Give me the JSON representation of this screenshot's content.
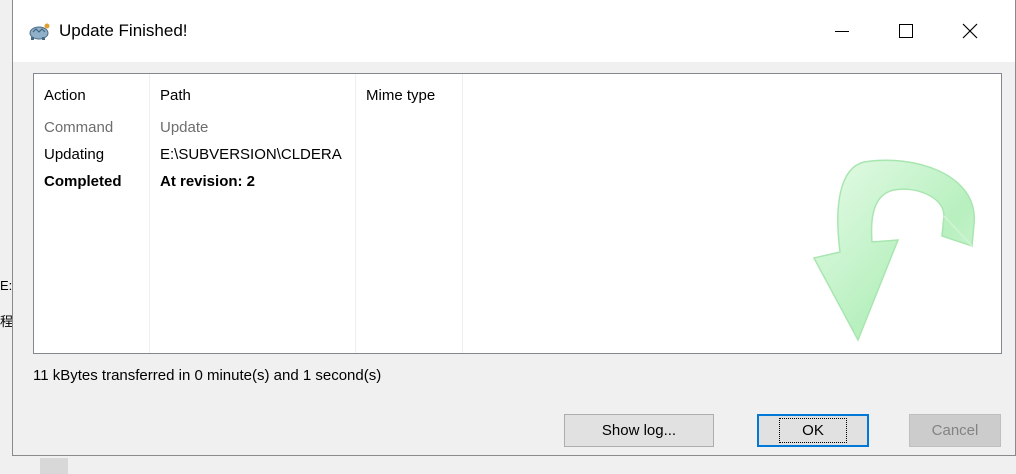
{
  "window": {
    "title": "Update Finished!",
    "controls": {
      "minimize": "minimize",
      "maximize": "maximize",
      "close": "close"
    }
  },
  "background": {
    "glyph_1": "E:",
    "glyph_2": "程"
  },
  "list": {
    "columns": [
      "Action",
      "Path",
      "Mime type"
    ],
    "rows": [
      {
        "action": "Command",
        "path": "Update",
        "style": "grey"
      },
      {
        "action": "Updating",
        "path": "E:\\SUBVERSION\\CLDERA",
        "style": "normal"
      },
      {
        "action": "Completed",
        "path": "At revision: 2",
        "style": "bold"
      }
    ]
  },
  "status": {
    "text": "11 kBytes transferred in 0 minute(s) and 1 second(s)"
  },
  "buttons": {
    "show_log": "Show log...",
    "ok": "OK",
    "cancel": "Cancel"
  },
  "icons": {
    "app": "tortoise-icon",
    "watermark": "update-arrow-icon"
  },
  "colors": {
    "accent": "#0078d7",
    "arrow_green": "#b8f0bf"
  }
}
